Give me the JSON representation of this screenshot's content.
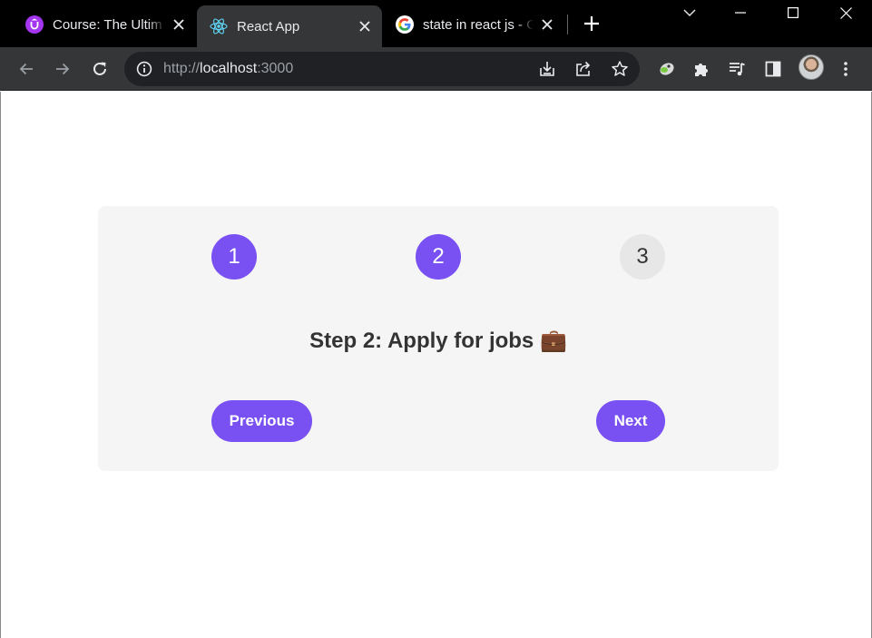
{
  "browser": {
    "tabs": [
      {
        "title": "Course: The Ultim",
        "favicon": "udemy-icon",
        "active": false
      },
      {
        "title": "React App",
        "favicon": "react-icon",
        "active": true
      },
      {
        "title": "state in react js - G",
        "favicon": "google-icon",
        "active": false
      }
    ],
    "address_bar": {
      "scheme": "http://",
      "host": "localhost",
      "port": ":3000"
    }
  },
  "app": {
    "steps": [
      "1",
      "2",
      "3"
    ],
    "current_step": 2,
    "message": "Step 2: Apply for jobs 💼",
    "previous_label": "Previous",
    "next_label": "Next"
  },
  "colors": {
    "accent": "#7950f2",
    "inactive_step": "#e7e7e7",
    "card_background": "#f5f5f5",
    "text": "#333333"
  }
}
